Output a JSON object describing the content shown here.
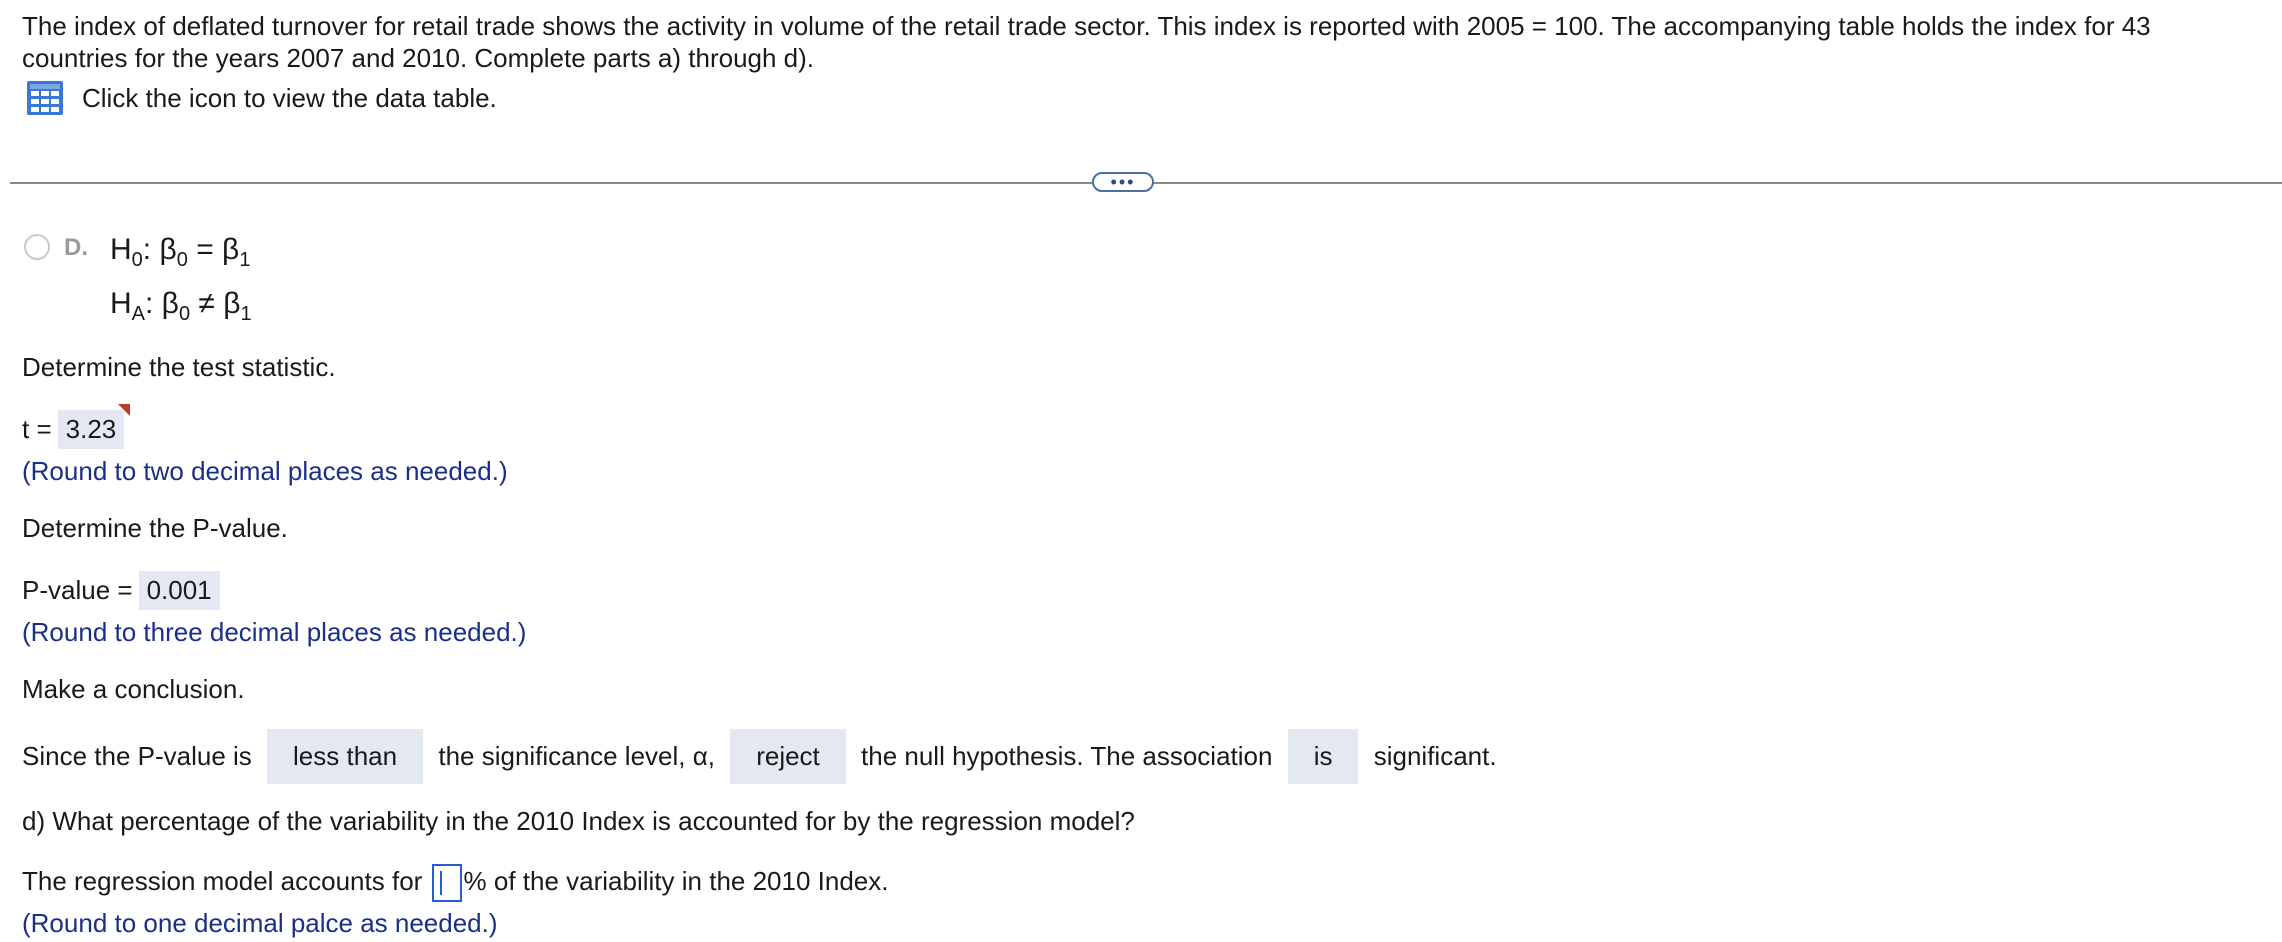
{
  "intro": {
    "text": "The index of deflated turnover for retail trade shows the activity in volume of the retail trade sector. This index is reported with 2005 = 100. The accompanying table holds the index for 43 countries for the years 2007 and 2010. Complete parts a) through d).",
    "table_link": "Click the icon to view the data table.",
    "icon": "table-icon"
  },
  "expander": {
    "label": "•••"
  },
  "option_d": {
    "letter": "D.",
    "h0_head": "H",
    "h0_sub": "0",
    "h0_mid": ": β",
    "h0_b0sub": "0",
    "h0_op": " = β",
    "h0_b1sub": "1",
    "ha_head": "H",
    "ha_sub": "A",
    "ha_mid": ": β",
    "ha_b0sub": "0",
    "ha_op": " ≠ β",
    "ha_b1sub": "1"
  },
  "test_stat": {
    "prompt": "Determine the test statistic.",
    "label": "t =",
    "value": "3.23",
    "hint": "(Round to two decimal places as needed.)"
  },
  "p_value": {
    "prompt": "Determine the P-value.",
    "label": "P-value =",
    "value": "0.001",
    "hint": "(Round to three decimal places as needed.)"
  },
  "conclusion": {
    "prompt": "Make a conclusion.",
    "part1": "Since the P-value is",
    "dropdown1": "less than",
    "part2": "the significance level, α,",
    "dropdown2": "reject",
    "part3": "the null hypothesis. The association",
    "dropdown3": "is",
    "part4": "significant."
  },
  "part_d": {
    "question": "d) What percentage of the variability in the 2010 Index is accounted for by the regression model?",
    "answer_prefix": "The regression model accounts for",
    "answer_suffix": "% of the variability in the 2010 Index.",
    "input_value": "",
    "hint": "(Round to one decimal palce as needed.)"
  }
}
